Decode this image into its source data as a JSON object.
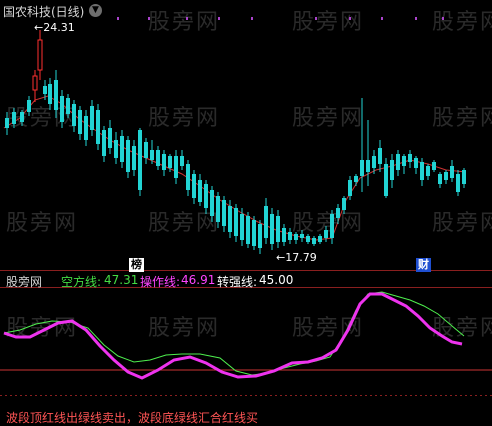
{
  "header": {
    "title": "国农科技(日线)",
    "menu_icon": "chevron-down-icon"
  },
  "watermark": {
    "text": "股旁网"
  },
  "price_chart": {
    "high_label": "24.31",
    "low_label": "17.79",
    "badges": [
      {
        "text": "榜",
        "bg": "#ffffff",
        "fg": "#000000"
      },
      {
        "text": "财",
        "bg": "#1f4fd1",
        "fg": "#ffffff"
      }
    ],
    "up_color": "#ff3030",
    "down_color": "#22d4d4",
    "ma_color": "#cc3333"
  },
  "indicator": {
    "site": "股旁网",
    "items": [
      {
        "label": "空方线:",
        "value": "47.31",
        "color": "#44dd44"
      },
      {
        "label": "操作线:",
        "value": "46.91",
        "color": "#ff44ff"
      },
      {
        "label": "转强线:",
        "value": "45.00",
        "color": "#ffffff"
      }
    ],
    "green_line_color": "#4ef04e",
    "magenta_line_color": "#ee33ee",
    "level_line_color": "#cc3333"
  },
  "footer_note": "波段顶红线出绿线卖出，波段底绿线汇合红线买"
}
